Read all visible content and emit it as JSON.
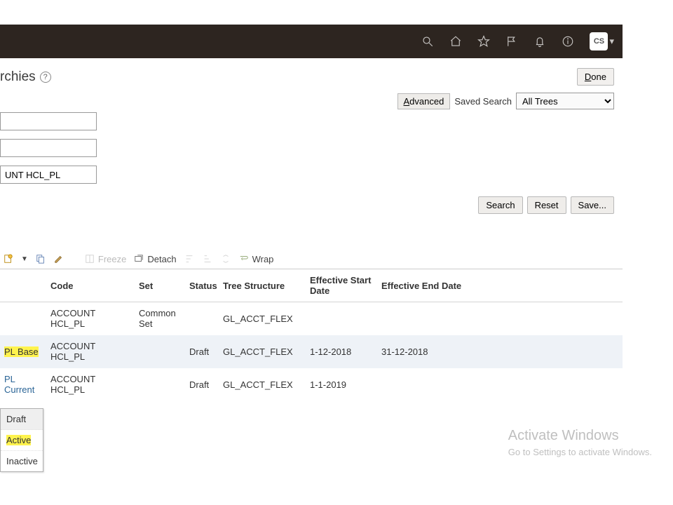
{
  "topbar": {
    "avatar_initials": "CS"
  },
  "header": {
    "title": "rchies",
    "done_label": "Done"
  },
  "search": {
    "advanced_label_pre": "A",
    "advanced_label_rest": "dvanced",
    "saved_search_label": "Saved Search",
    "saved_search_value": "All Trees",
    "search_btn": "Search",
    "reset_btn": "Reset",
    "save_btn": "Save..."
  },
  "filters": {
    "field1": "",
    "field2": "",
    "field3": "UNT HCL_PL"
  },
  "toolbar": {
    "freeze": "Freeze",
    "detach": "Detach",
    "wrap": "Wrap"
  },
  "table": {
    "cols": {
      "tree": "",
      "code": "Code",
      "set": "Set",
      "status": "Status",
      "structure": "Tree Structure",
      "start": "Effective Start Date",
      "end": "Effective End Date"
    },
    "rows": [
      {
        "tree": "",
        "code": "ACCOUNT HCL_PL",
        "set": "Common Set",
        "status": "",
        "structure": "GL_ACCT_FLEX",
        "start": "",
        "end": "",
        "hl": false,
        "sel": false,
        "link": false
      },
      {
        "tree": "PL Base",
        "code": "ACCOUNT HCL_PL",
        "set": "",
        "status": "Draft",
        "structure": "GL_ACCT_FLEX",
        "start": "1-12-2018",
        "end": "31-12-2018",
        "hl": true,
        "sel": true,
        "link": false
      },
      {
        "tree": "PL Current",
        "code": "ACCOUNT HCL_PL",
        "set": "",
        "status": "Draft",
        "structure": "GL_ACCT_FLEX",
        "start": "1-1-2019",
        "end": "",
        "hl": false,
        "sel": false,
        "link": true
      }
    ]
  },
  "status_menu": {
    "items": [
      "Draft",
      "Active",
      "Inactive"
    ],
    "selected": 0,
    "highlighted": 1
  },
  "watermark": {
    "title": "Activate Windows",
    "subtitle": "Go to Settings to activate Windows."
  }
}
